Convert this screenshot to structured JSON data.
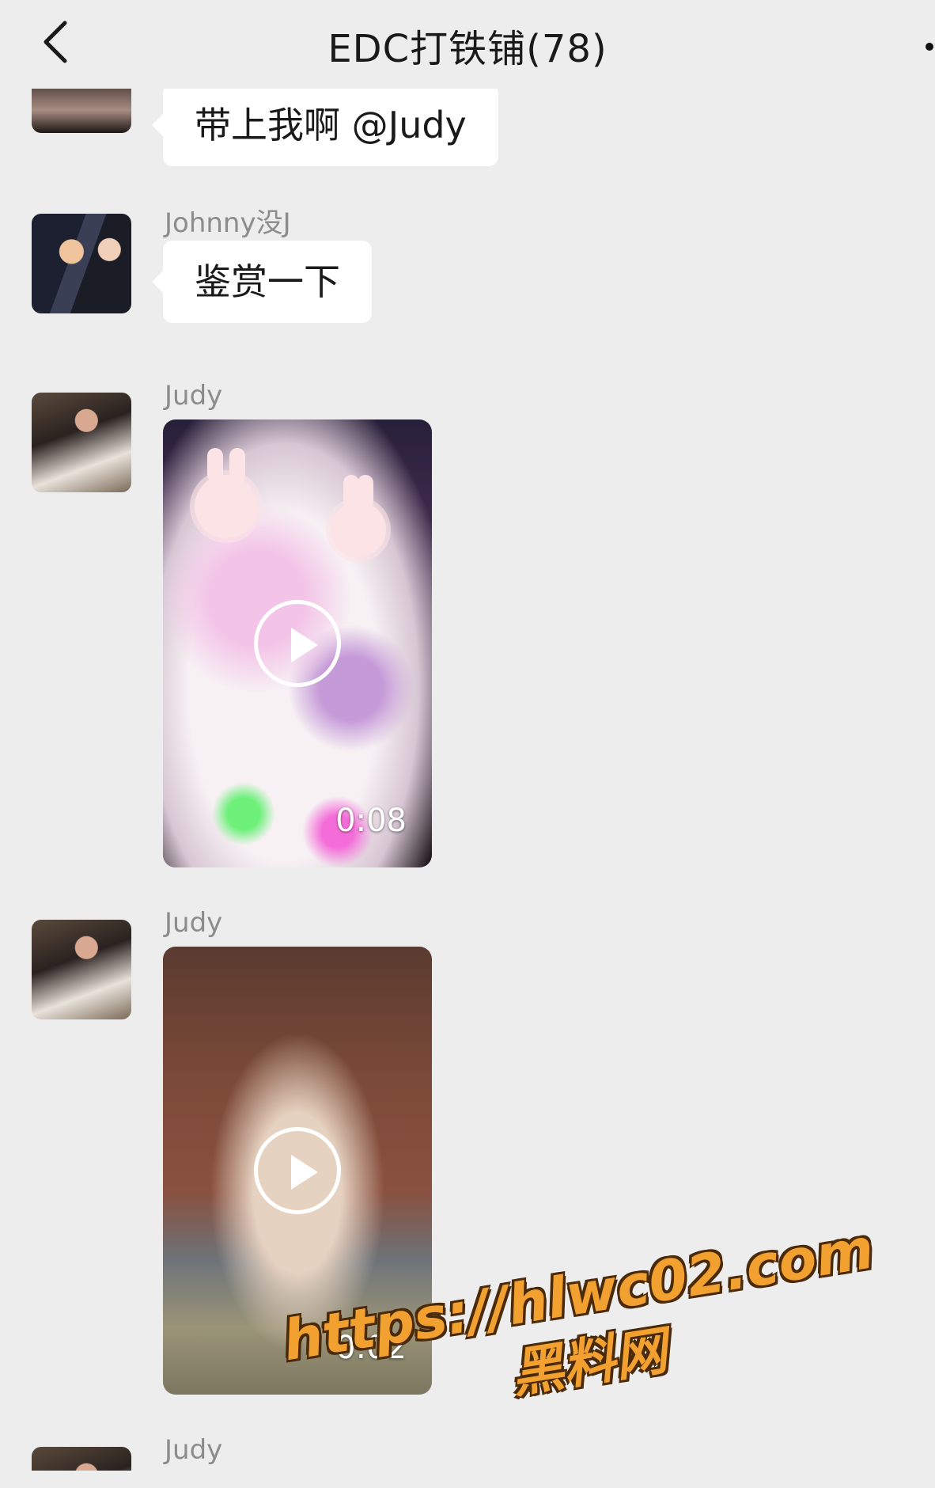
{
  "header": {
    "title": "EDC打铁铺(78)",
    "back_icon": "chevron-left-icon",
    "more_icon": "more-dots-icon"
  },
  "messages": [
    {
      "type": "text",
      "sender": "",
      "text": "带上我啊 @Judy"
    },
    {
      "type": "text",
      "sender": "Johnny没J",
      "text": "鉴赏一下"
    },
    {
      "type": "video",
      "sender": "Judy",
      "duration": "0:08"
    },
    {
      "type": "video",
      "sender": "Judy",
      "duration": "0:02"
    },
    {
      "type": "partial",
      "sender": "Judy"
    }
  ],
  "watermark": {
    "url": "https://hlwc02.com",
    "name": "黑料网"
  },
  "colors": {
    "background": "#ededed",
    "bubble": "#ffffff",
    "watermark": "#f2a130"
  }
}
